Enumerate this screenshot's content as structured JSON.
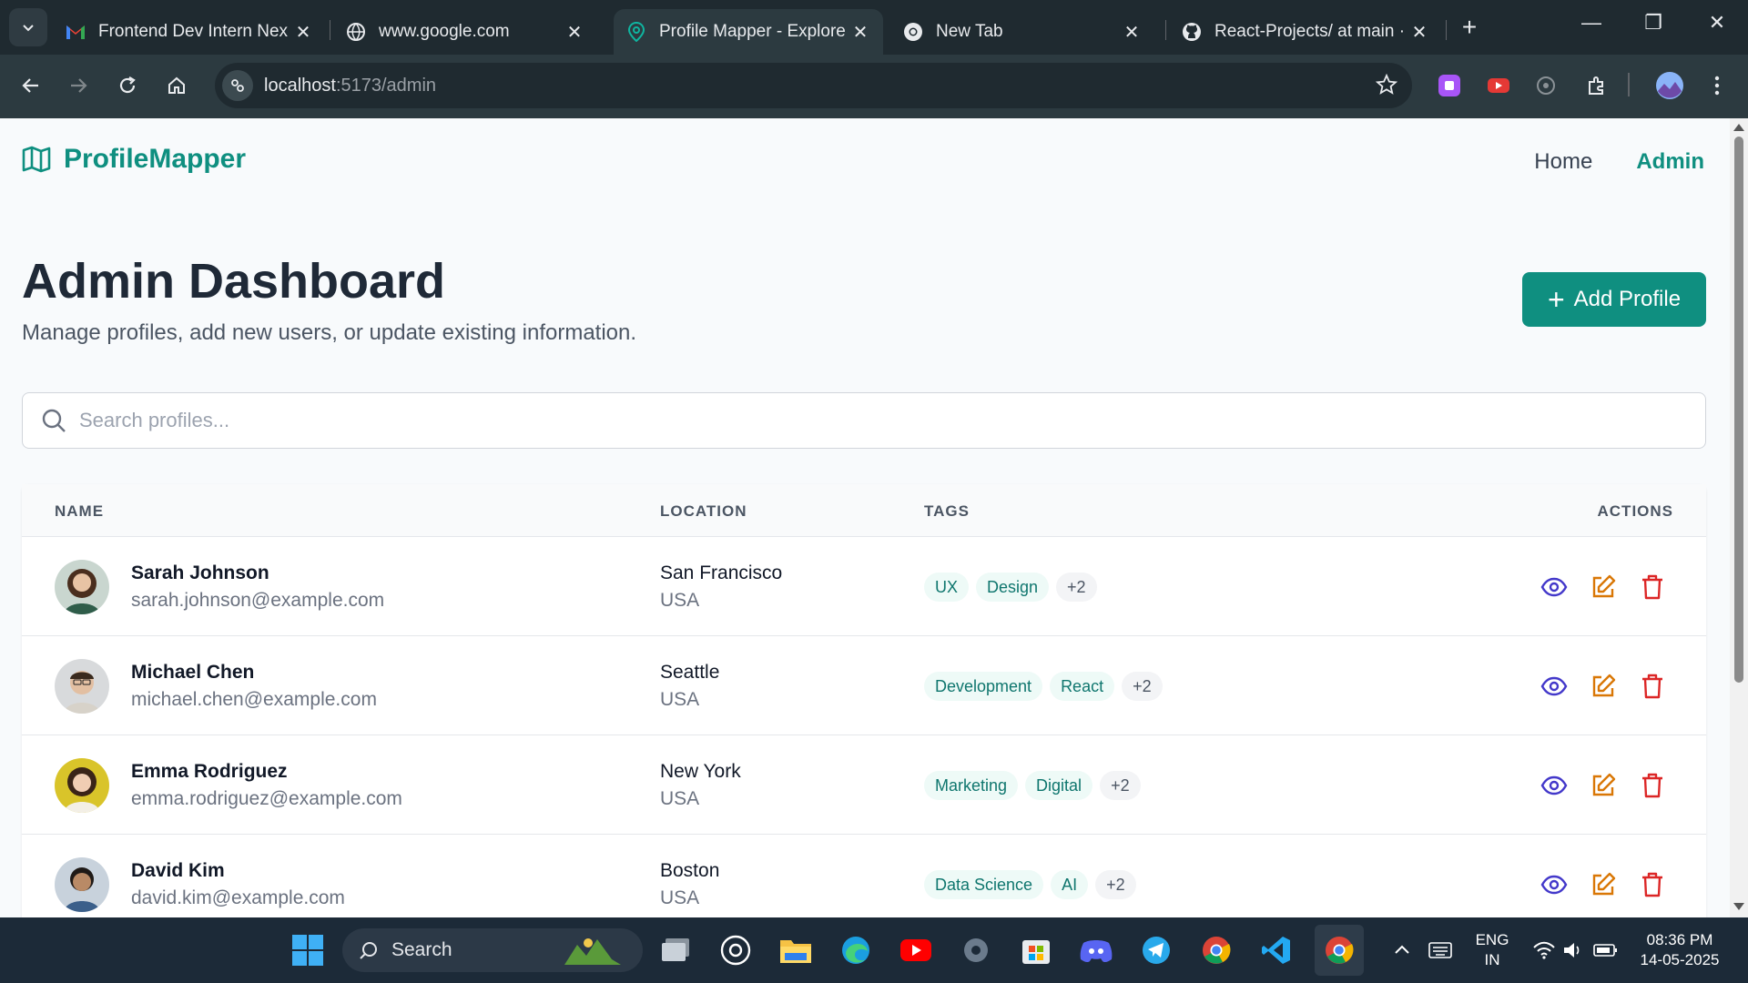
{
  "browser": {
    "tabs": [
      {
        "title": "Frontend Dev Intern Next",
        "icon": "gmail-icon"
      },
      {
        "title": "www.google.com",
        "icon": "globe-icon"
      },
      {
        "title": "Profile Mapper - Explore",
        "icon": "location-pin-icon"
      },
      {
        "title": "New Tab",
        "icon": "chrome-icon"
      },
      {
        "title": "React-Projects/ at main ·",
        "icon": "github-icon"
      }
    ],
    "url_host": "localhost",
    "url_path": ":5173/admin"
  },
  "app": {
    "brand": "ProfileMapper",
    "nav": {
      "home": "Home",
      "admin": "Admin"
    },
    "title": "Admin Dashboard",
    "subtitle": "Manage profiles, add new users, or update existing information.",
    "add_button": "Add Profile",
    "search_placeholder": "Search profiles...",
    "columns": {
      "name": "NAME",
      "location": "LOCATION",
      "tags": "TAGS",
      "actions": "ACTIONS"
    },
    "profiles": [
      {
        "name": "Sarah Johnson",
        "email": "sarah.johnson@example.com",
        "city": "San Francisco",
        "country": "USA",
        "tags": [
          "UX",
          "Design"
        ],
        "more": "+2"
      },
      {
        "name": "Michael Chen",
        "email": "michael.chen@example.com",
        "city": "Seattle",
        "country": "USA",
        "tags": [
          "Development",
          "React"
        ],
        "more": "+2"
      },
      {
        "name": "Emma Rodriguez",
        "email": "emma.rodriguez@example.com",
        "city": "New York",
        "country": "USA",
        "tags": [
          "Marketing",
          "Digital"
        ],
        "more": "+2"
      },
      {
        "name": "David Kim",
        "email": "david.kim@example.com",
        "city": "Boston",
        "country": "USA",
        "tags": [
          "Data Science",
          "AI"
        ],
        "more": "+2"
      }
    ]
  },
  "taskbar": {
    "search_label": "Search",
    "lang": "ENG",
    "region": "IN",
    "time": "08:36 PM",
    "date": "14-05-2025"
  },
  "colors": {
    "accent": "#0f8f80",
    "view": "#4338ca",
    "edit": "#d97706",
    "delete": "#dc2626"
  }
}
